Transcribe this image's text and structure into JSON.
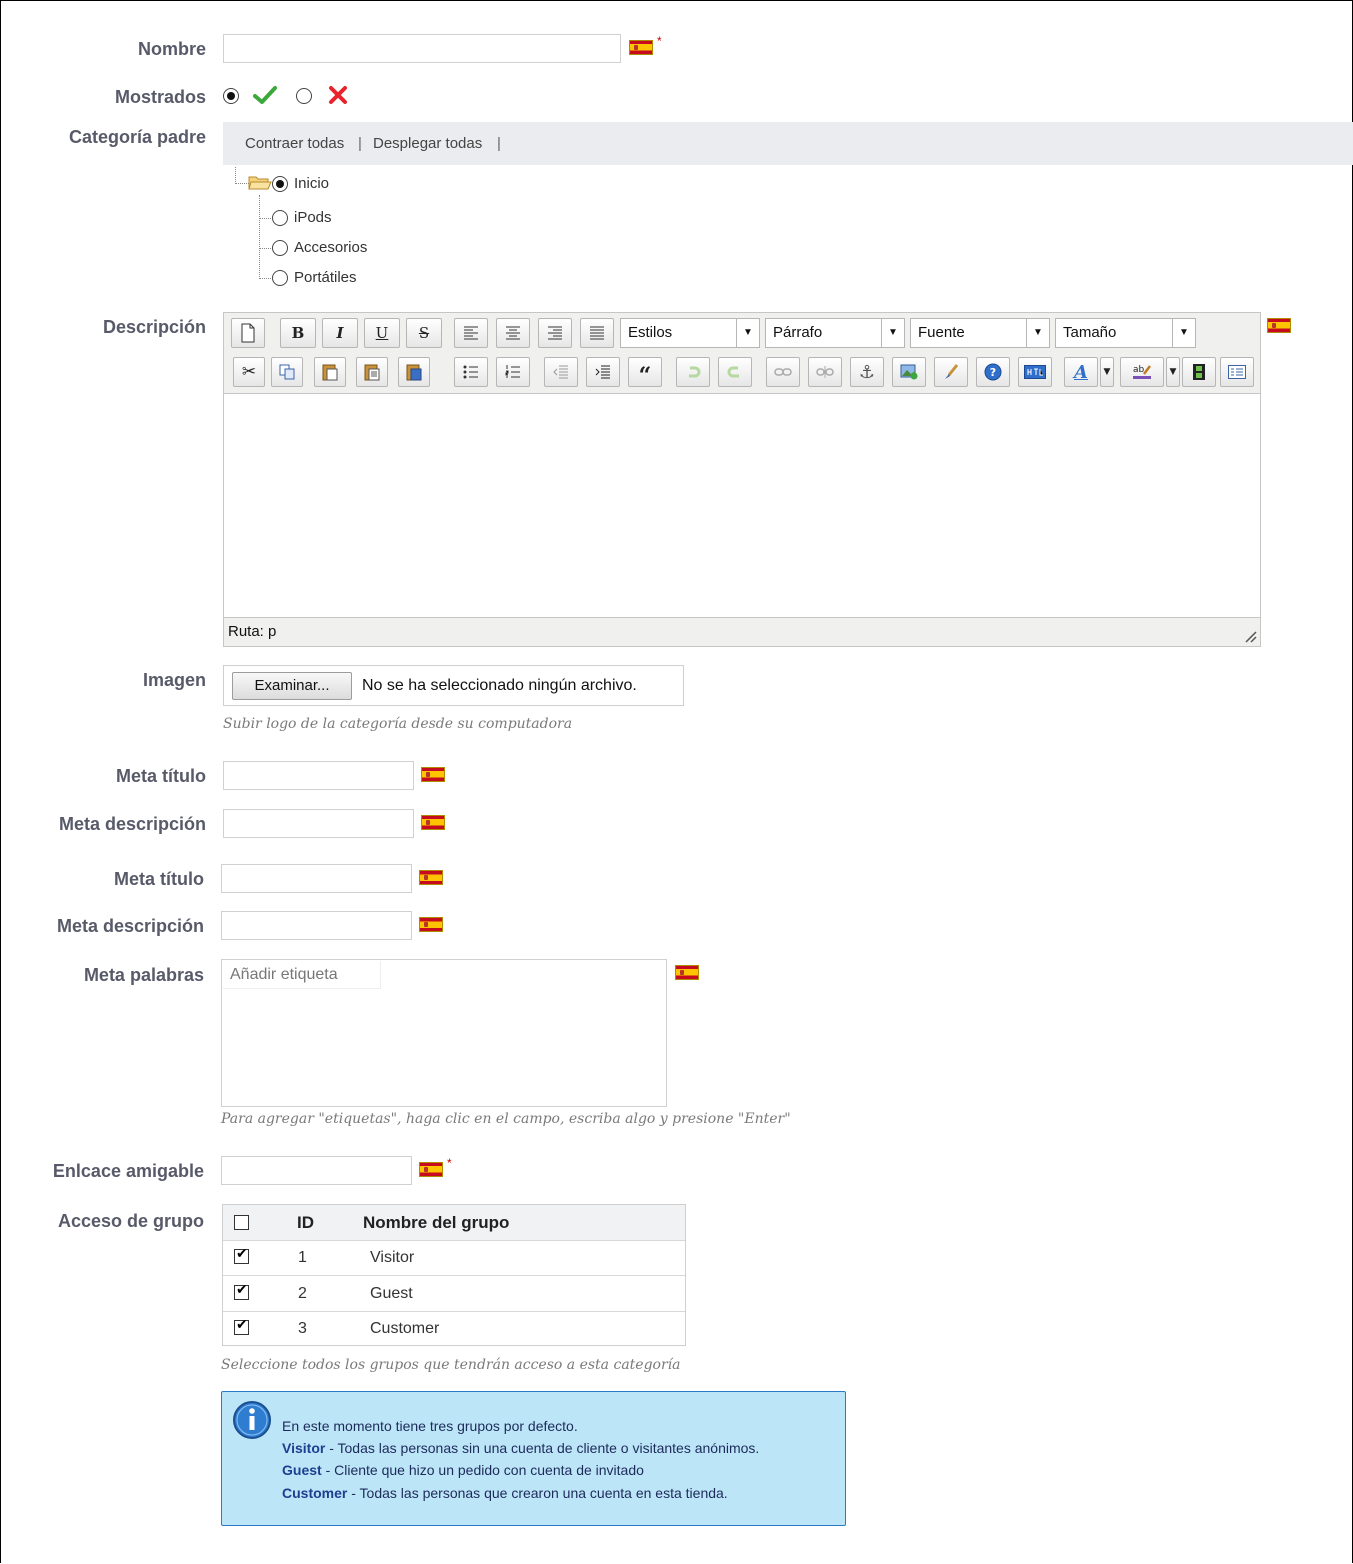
{
  "form": {
    "name_label": "Nombre",
    "displayed_label": "Mostrados",
    "parent_label": "Categoría padre",
    "description_label": "Descripción",
    "image_label": "Imagen",
    "meta_title_label": "Meta título",
    "meta_desc_label": "Meta descripción",
    "meta_keywords_label": "Meta palabras",
    "friendly_url_label": "Enlcace amigable",
    "group_access_label": "Acceso de grupo",
    "required_mark": "*"
  },
  "tree": {
    "collapse_all": "Contraer todas",
    "expand_all": "Desplegar todas",
    "separator": "|",
    "items": [
      "Inicio",
      "iPods",
      "Accesorios",
      "Portátiles"
    ]
  },
  "editor": {
    "styles": "Estilos",
    "paragraph": "Párrafo",
    "font": "Fuente",
    "size": "Tamaño",
    "path": "Ruta: p",
    "bold": "B",
    "italic": "I",
    "underline": "U",
    "strike": "S"
  },
  "image": {
    "browse": "Examinar...",
    "no_file": "No se ha seleccionado ningún archivo.",
    "hint": "Subir logo de la categoría desde su computadora"
  },
  "keywords": {
    "placeholder": "Añadir etiqueta",
    "hint": "Para agregar \"etiquetas\", haga clic en el campo, escriba algo y presione \"Enter\""
  },
  "groups": {
    "col_id": "ID",
    "col_name": "Nombre del grupo",
    "rows": [
      {
        "id": "1",
        "name": "Visitor",
        "checked": true
      },
      {
        "id": "2",
        "name": "Guest",
        "checked": true
      },
      {
        "id": "3",
        "name": "Customer",
        "checked": true
      }
    ],
    "hint": "Seleccione todos los grupos que tendrán acceso a esta categoría"
  },
  "info": {
    "intro": "En este momento tiene tres grupos por defecto.",
    "visitor_term": "Visitor",
    "visitor_desc": " - Todas las personas sin una cuenta de cliente o visitantes anónimos.",
    "guest_term": "Guest",
    "guest_desc": " - Cliente que hizo un pedido con cuenta de invitado",
    "customer_term": "Customer",
    "customer_desc": " - Todas las personas que crearon una cuenta en esta tienda."
  },
  "colors": {
    "label": "#585a69",
    "check_green": "#3ca83c",
    "cross_red": "#e8232b",
    "info_bg": "#bde5f8",
    "info_border": "#2a7ac8",
    "info_term": "#1c3f8f"
  },
  "icons": [
    "spain-flag-icon",
    "check-icon",
    "cross-icon",
    "folder-icon",
    "info-icon"
  ]
}
